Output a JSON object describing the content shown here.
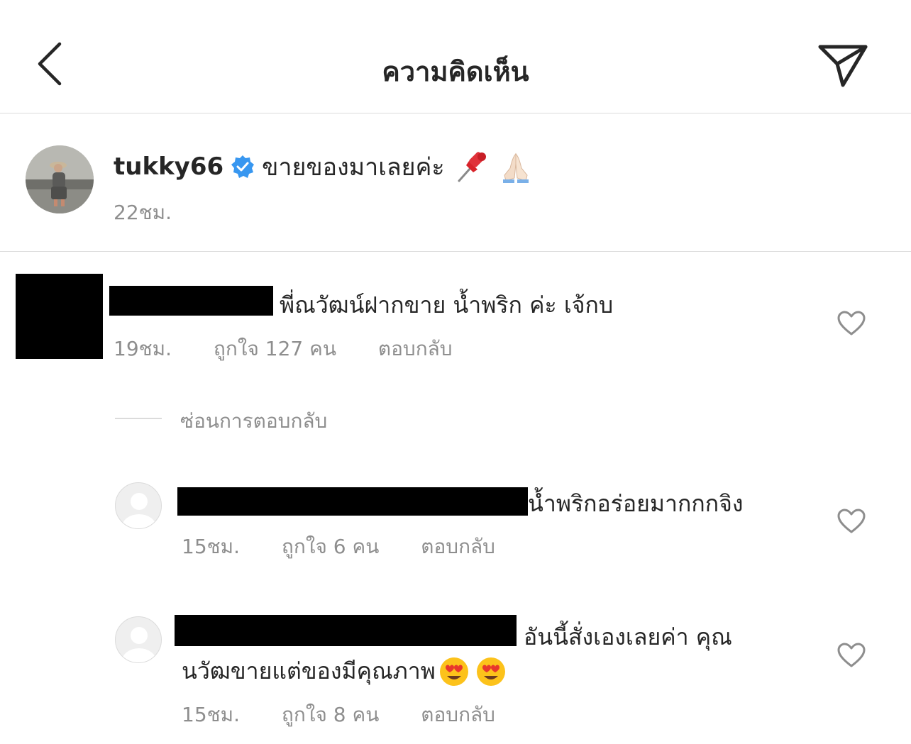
{
  "header": {
    "title": "ความคิดเห็น",
    "back_icon": "chevron-left-icon",
    "send_icon": "paper-plane-icon"
  },
  "caption": {
    "username": "tukky66",
    "verified": true,
    "text": "ขายของมาเลยค่ะ",
    "emojis": [
      "pushpin-emoji",
      "folded-hands-emoji"
    ],
    "time": "22ชม."
  },
  "comments": [
    {
      "text": "พี่ณวัฒน์ฝากขาย น้ำพริก ค่ะ เจ้กบ",
      "time": "19ชม.",
      "likes": "ถูกใจ 127 คน",
      "reply": "ตอบกลับ"
    }
  ],
  "hide_replies": "ซ่อนการตอบกลับ",
  "replies": [
    {
      "text": "น้ำพริกอร่อยมากกกจิง",
      "time": "15ชม.",
      "likes": "ถูกใจ 6 คน",
      "reply": "ตอบกลับ"
    },
    {
      "text_line1": "อันนี้สั่งเองเลยค่า คุณ",
      "text_line2": "นวัฒขายแต่ของมีคุณภาพ",
      "time": "15ชม.",
      "likes": "ถูกใจ 8 คน",
      "reply": "ตอบกลับ"
    }
  ],
  "colors": {
    "text": "#262626",
    "muted": "#8e8e8e",
    "divider": "#dbdbdb",
    "verified_blue": "#3897f0"
  }
}
